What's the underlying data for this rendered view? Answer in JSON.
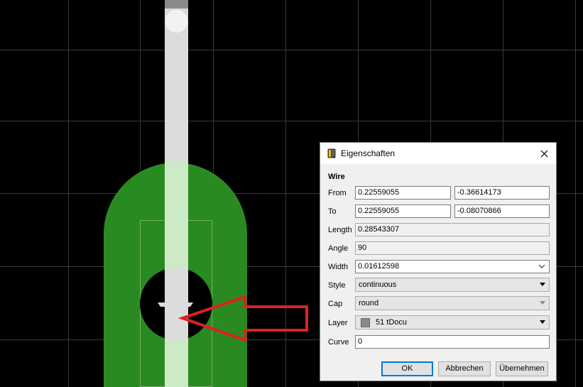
{
  "canvas": {
    "background": "#000000",
    "grid_color": "#3a3a3a",
    "pad_color": "#2a8a22",
    "wire_color": "#dcdcdc",
    "annotation_arrow_color": "#e02020"
  },
  "dialog": {
    "title": "Eigenschaften",
    "icons": {
      "title": "properties-icon",
      "close": "close-icon"
    },
    "section": "Wire",
    "labels": {
      "from": "From",
      "to": "To",
      "length": "Length",
      "angle": "Angle",
      "width": "Width",
      "style": "Style",
      "cap": "Cap",
      "layer": "Layer",
      "curve": "Curve"
    },
    "from_x": "0.22559055",
    "from_y": "-0.36614173",
    "to_x": "0.22559055",
    "to_y": "-0.08070866",
    "length": "0.28543307",
    "angle": "90",
    "width": "0.01612598",
    "style": "continuous",
    "cap": "round",
    "layer": "51 tDocu",
    "layer_color": "#8a8a8a",
    "curve": "0",
    "buttons": {
      "ok": "OK",
      "cancel": "Abbrechen",
      "apply": "Übernehmen"
    }
  }
}
